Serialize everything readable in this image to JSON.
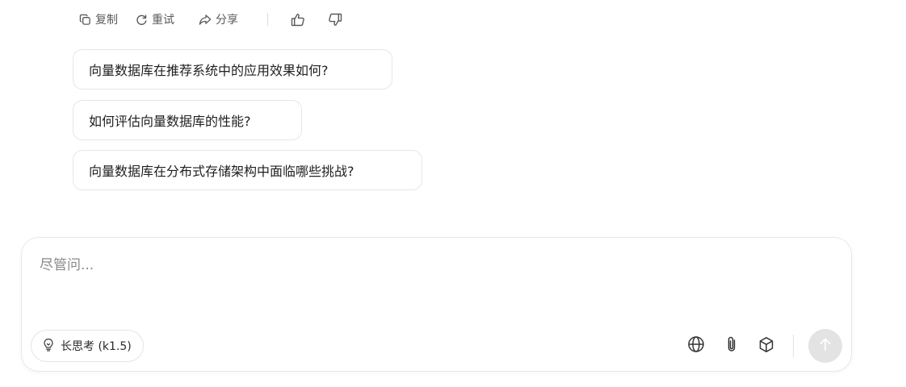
{
  "actions": {
    "copy_label": "复制",
    "retry_label": "重试",
    "share_label": "分享"
  },
  "suggestions": [
    "向量数据库在推荐系统中的应用效果如何?",
    "如何评估向量数据库的性能?",
    "向量数据库在分布式存储架构中面临哪些挑战?"
  ],
  "composer": {
    "placeholder": "尽管问...",
    "think_label": "长思考 (k1.5)"
  },
  "icons": {
    "copy": "copy-icon",
    "retry": "refresh-icon",
    "share": "share-icon",
    "like": "thumb-up-icon",
    "dislike": "thumb-down-icon",
    "think": "lightbulb-icon",
    "web": "globe-icon",
    "attach": "paperclip-icon",
    "tools": "cube-icon",
    "send": "arrow-up-icon"
  },
  "colors": {
    "send_button_disabled": "#e3e3e3",
    "icon_gray": "#5a5a5a",
    "border": "#e6e6e6"
  }
}
